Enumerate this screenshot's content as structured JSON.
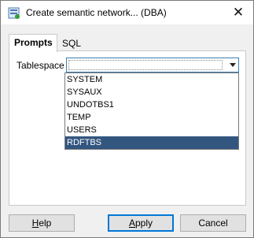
{
  "window": {
    "title": "Create semantic network... (DBA)",
    "close_label": "✕"
  },
  "tabs": [
    {
      "label": "Prompts",
      "active": true
    },
    {
      "label": "SQL",
      "active": false
    }
  ],
  "form": {
    "tablespace_label": "Tablespace",
    "tablespace_value": ""
  },
  "dropdown": {
    "options": [
      "SYSTEM",
      "SYSAUX",
      "UNDOTBS1",
      "TEMP",
      "USERS",
      "RDFTBS"
    ],
    "highlighted": "RDFTBS"
  },
  "buttons": {
    "help": {
      "mnemonic": "H",
      "rest": "elp"
    },
    "apply": {
      "mnemonic": "A",
      "rest": "pply"
    },
    "cancel": {
      "label": "Cancel"
    }
  },
  "colors": {
    "selection": "#33567f",
    "focus_border": "#0078d7"
  }
}
